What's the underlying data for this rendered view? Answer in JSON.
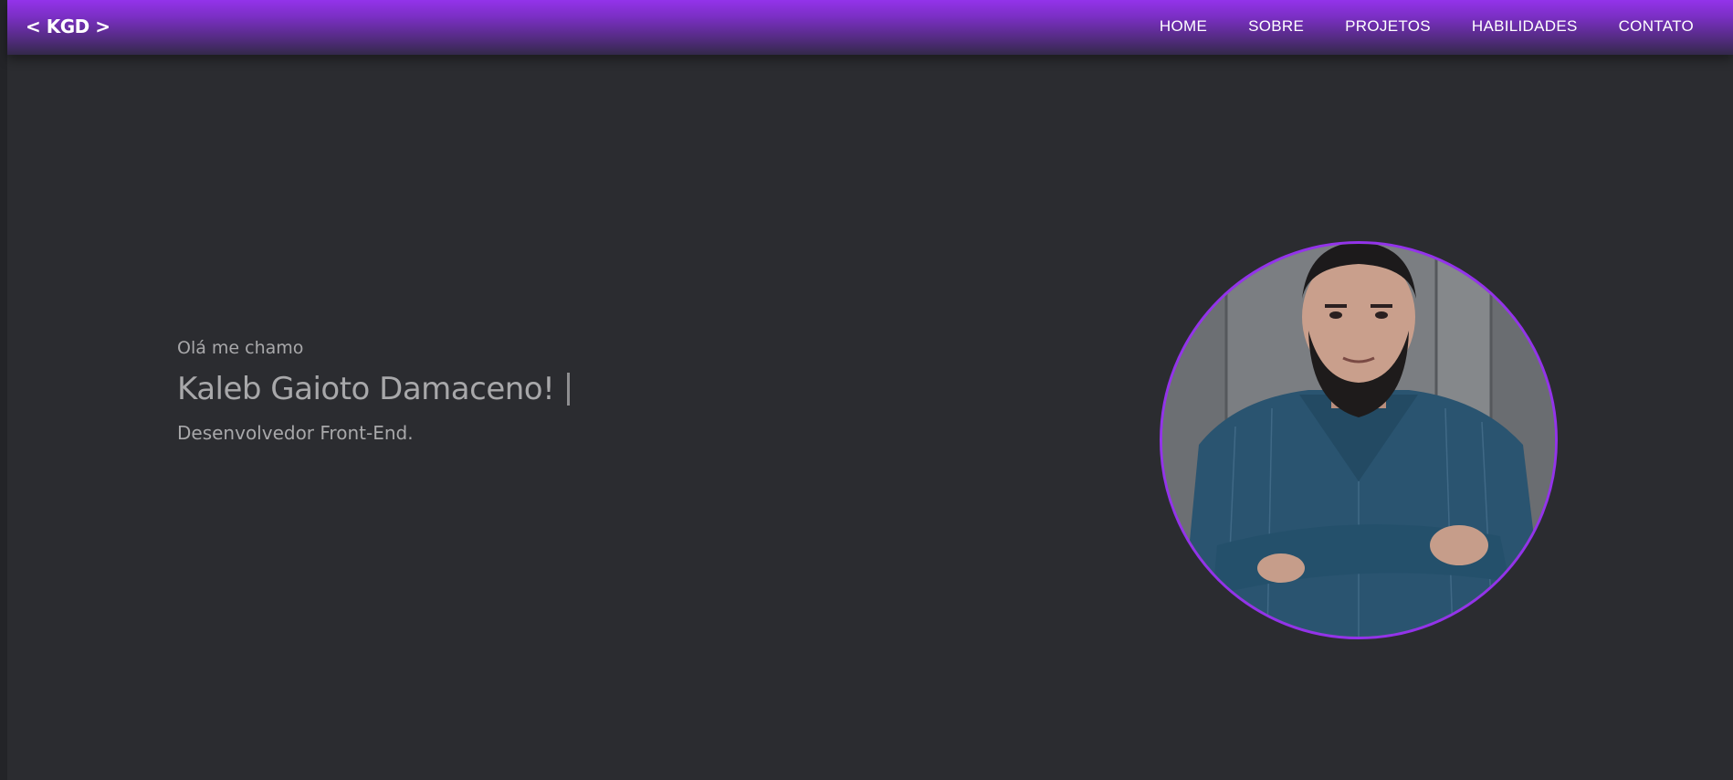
{
  "header": {
    "logo": "< KGD >",
    "nav": [
      {
        "label": "HOME"
      },
      {
        "label": "SOBRE"
      },
      {
        "label": "PROJETOS"
      },
      {
        "label": "HABILIDADES"
      },
      {
        "label": "CONTATO"
      }
    ]
  },
  "hero": {
    "greeting": "Olá me chamo",
    "name": "Kaleb Gaioto Damaceno!",
    "role": "Desenvolvedor Front-End."
  },
  "colors": {
    "accent": "#9333ea",
    "background": "#2b2c30",
    "text_muted": "#a8a8aa"
  }
}
